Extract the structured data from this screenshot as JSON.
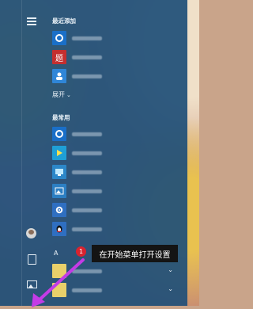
{
  "header": {
    "menu_icon": "hamburger-icon"
  },
  "sections": {
    "recent": "最近添加",
    "expand": "展开",
    "most_used": "最常用",
    "alpha_a": "A"
  },
  "recent_apps": [
    {
      "icon": "qq-browser-icon",
      "color": "#1a6fc8"
    },
    {
      "icon": "red-app-icon",
      "color": "#c42f2f",
      "glyph": "题"
    },
    {
      "icon": "user-app-icon",
      "color": "#2f86d8"
    }
  ],
  "most_used_apps": [
    {
      "icon": "qq-browser-icon",
      "color": "#1a6fc8"
    },
    {
      "icon": "media-player-icon",
      "color": "#1f9fd6"
    },
    {
      "icon": "monitor-app-icon",
      "color": "#2c87c9"
    },
    {
      "icon": "photos-icon",
      "color": "#2c7fc3"
    },
    {
      "icon": "settings-gear-icon",
      "color": "#2f6fc1"
    },
    {
      "icon": "qq-penguin-icon",
      "color": "#2f6fc1"
    }
  ],
  "left_rail": {
    "avatar": "user-avatar",
    "documents": "document-icon",
    "pictures": "pictures-icon"
  },
  "annotation": {
    "badge": "1",
    "text": "在开始菜单打开设置",
    "arrow_color": "#c43be6"
  }
}
